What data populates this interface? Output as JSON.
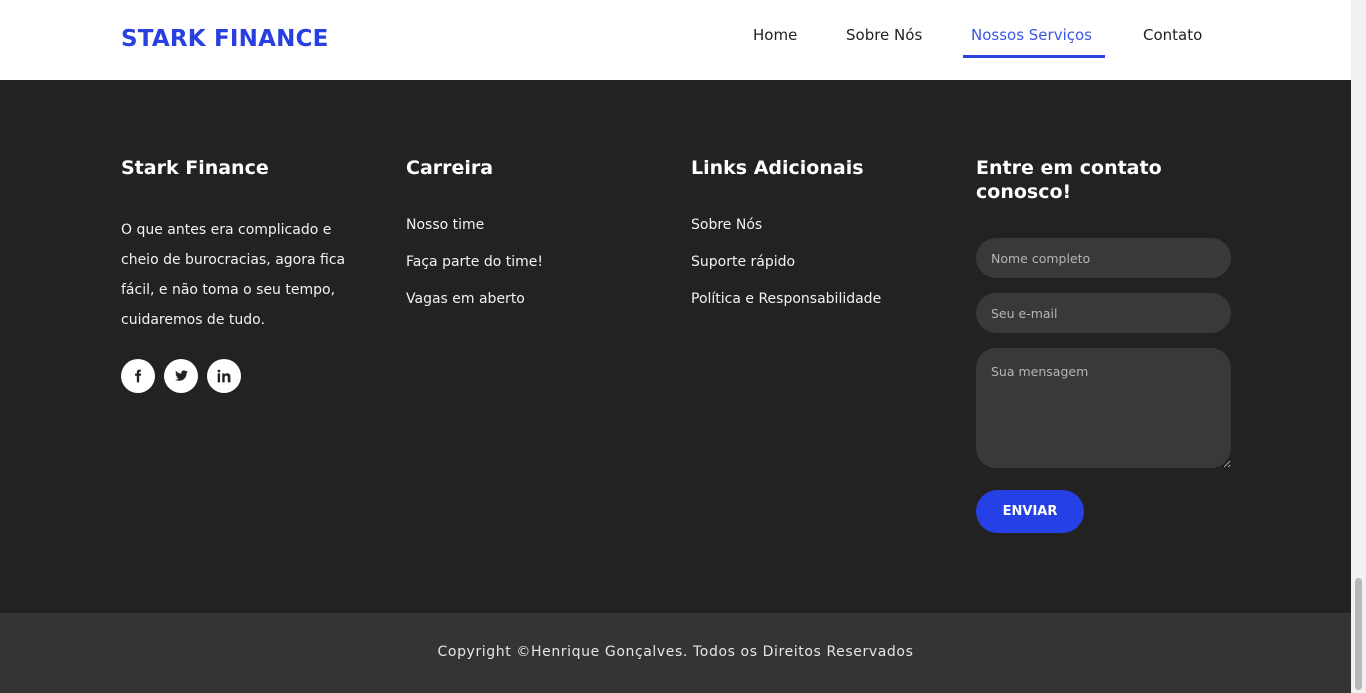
{
  "header": {
    "logo": "STARK FINANCE",
    "nav": [
      {
        "label": "Home",
        "active": false
      },
      {
        "label": "Sobre Nós",
        "active": false
      },
      {
        "label": "Nossos Serviços",
        "active": true
      },
      {
        "label": "Contato",
        "active": false
      }
    ]
  },
  "footer": {
    "about": {
      "title": "Stark Finance",
      "text": "O que antes era complicado e cheio de burocracias, agora fica fácil, e não toma o seu tempo, cuidaremos de tudo.",
      "social": [
        {
          "icon": "facebook-icon",
          "glyph": "f"
        },
        {
          "icon": "twitter-icon",
          "glyph": "t"
        },
        {
          "icon": "linkedin-icon",
          "glyph": "in"
        }
      ]
    },
    "career": {
      "title": "Carreira",
      "links": [
        "Nosso time",
        "Faça parte do time!",
        "Vagas em aberto"
      ]
    },
    "additional": {
      "title": "Links Adicionais",
      "links": [
        "Sobre Nós",
        "Suporte rápido",
        "Política e Responsabilidade"
      ]
    },
    "contact": {
      "title": "Entre em contato conosco!",
      "name_placeholder": "Nome completo",
      "email_placeholder": "Seu e-mail",
      "message_placeholder": "Sua mensagem",
      "send_label": "ENVIAR"
    },
    "copyright": "Copyright ©Henrique Gonçalves. Todos os Direitos Reservados"
  },
  "colors": {
    "brand": "#2940e0",
    "footer_bg": "#232223",
    "copyright_bg": "#353435"
  }
}
